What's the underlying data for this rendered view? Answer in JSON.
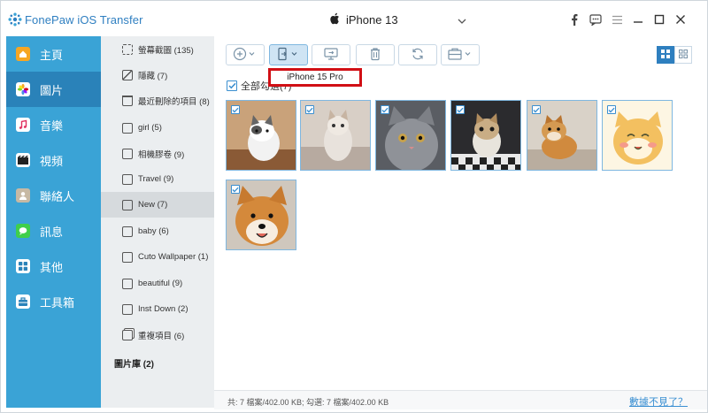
{
  "app": {
    "title": "FonePaw iOS Transfer",
    "accent": "#3aa3d6",
    "accent_dark": "#2a82b9"
  },
  "device": {
    "name": "iPhone 13",
    "icon": "apple-icon"
  },
  "window_controls": [
    "facebook-icon",
    "feedback-icon",
    "menu-icon",
    "minimize-icon",
    "maximize-icon",
    "close-icon"
  ],
  "sidebar": {
    "items": [
      {
        "label": "主頁",
        "icon": "home-icon",
        "active": false
      },
      {
        "label": "圖片",
        "icon": "photos-icon",
        "active": true
      },
      {
        "label": "音樂",
        "icon": "music-icon",
        "active": false
      },
      {
        "label": "視頻",
        "icon": "video-icon",
        "active": false
      },
      {
        "label": "聯絡人",
        "icon": "contacts-icon",
        "active": false
      },
      {
        "label": "訊息",
        "icon": "messages-icon",
        "active": false
      },
      {
        "label": "其他",
        "icon": "others-icon",
        "active": false
      },
      {
        "label": "工具箱",
        "icon": "toolbox-icon",
        "active": false
      }
    ]
  },
  "albums": {
    "items": [
      {
        "label": "螢幕截圖 (135)"
      },
      {
        "label": "隱藏 (7)"
      },
      {
        "label": "最近刪除的項目 (8)"
      },
      {
        "label": "girl (5)"
      },
      {
        "label": "相機膠卷 (9)"
      },
      {
        "label": "Travel (9)"
      },
      {
        "label": "New (7)"
      },
      {
        "label": "baby (6)"
      },
      {
        "label": "Cuto Wallpaper (1)"
      },
      {
        "label": "beautiful (9)"
      },
      {
        "label": "Inst Down (2)"
      },
      {
        "label": "重複項目 (6)"
      }
    ],
    "library_label": "圖片庫 (2)"
  },
  "toolbar": {
    "buttons": [
      "add-icon",
      "export-to-device-icon",
      "export-to-pc-icon",
      "delete-icon",
      "convert-icon",
      "toolbox-icon"
    ],
    "dropdown_item": "iPhone 15 Pro",
    "view_modes": [
      "grid-view-icon",
      "list-view-icon"
    ]
  },
  "content": {
    "select_all_label": "全部勾選(7)",
    "photos": [
      {
        "name": "kitten-1",
        "checked": true
      },
      {
        "name": "kitten-2",
        "checked": true
      },
      {
        "name": "grey-cat",
        "checked": true
      },
      {
        "name": "tabby-cat",
        "checked": true
      },
      {
        "name": "shiba-puppy",
        "checked": true
      },
      {
        "name": "cartoon-shiba",
        "checked": true
      },
      {
        "name": "shiba-face",
        "checked": true
      }
    ]
  },
  "status": {
    "summary": "共: 7 檔案/402.00 KB; 勾選: 7 檔案/402.00 KB",
    "link": "數據不見了？"
  }
}
